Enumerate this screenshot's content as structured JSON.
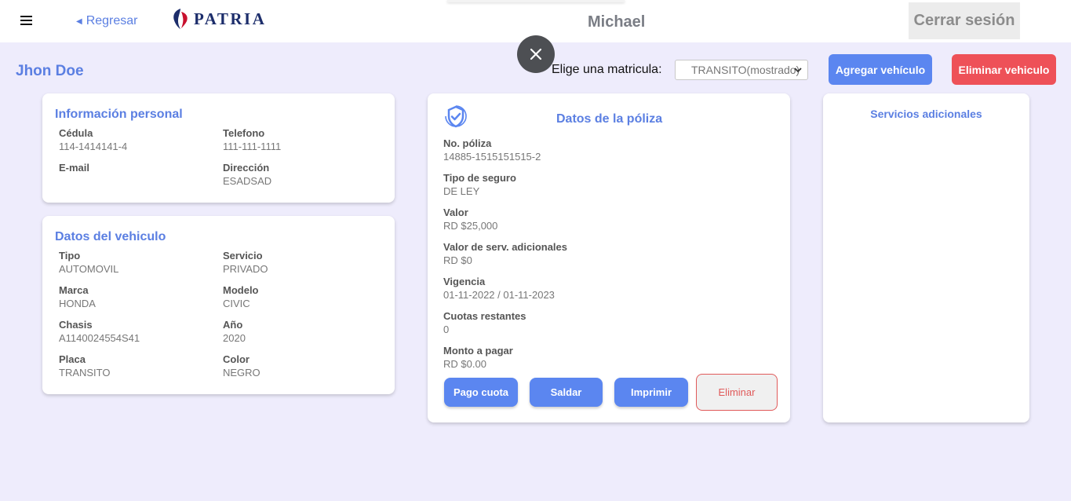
{
  "header": {
    "back_label": "Regresar",
    "brand": "PATRIA",
    "username": "Michael",
    "logout_label": "Cerrar sesión"
  },
  "toolbar": {
    "client_name": "Jhon Doe",
    "plate_label": "Elige una matricula:",
    "plate_selected": "TRANSITO(mostrado)",
    "add_vehicle_label": "Agregar vehículo",
    "delete_vehicle_label": "Eliminar vehiculo"
  },
  "personal": {
    "title": "Información personal",
    "fields": [
      {
        "label": "Cédula",
        "value": "114-1414141-4"
      },
      {
        "label": "Telefono",
        "value": "111-111-1111"
      },
      {
        "label": "E-mail",
        "value": ""
      },
      {
        "label": "Dirección",
        "value": "ESADSAD"
      }
    ]
  },
  "vehicle": {
    "title": "Datos del vehiculo",
    "fields": [
      {
        "label": "Tipo",
        "value": "AUTOMOVIL"
      },
      {
        "label": "Servicio",
        "value": "PRIVADO"
      },
      {
        "label": "Marca",
        "value": "HONDA"
      },
      {
        "label": "Modelo",
        "value": "CIVIC"
      },
      {
        "label": "Chasis",
        "value": "A1140024554S41"
      },
      {
        "label": "Año",
        "value": "2020"
      },
      {
        "label": "Placa",
        "value": "TRANSITO"
      },
      {
        "label": "Color",
        "value": "NEGRO"
      }
    ]
  },
  "policy": {
    "title": "Datos de la póliza",
    "icon": "shield-check-icon",
    "fields": [
      {
        "label": "No. póliza",
        "value": "14885-1515151515-2"
      },
      {
        "label": "Tipo de seguro",
        "value": "DE LEY"
      },
      {
        "label": "Valor",
        "value": "RD $25,000"
      },
      {
        "label": "Valor de serv. adicionales",
        "value": "RD $0"
      },
      {
        "label": "Vigencia",
        "value": "01-11-2022 / 01-11-2023"
      },
      {
        "label": "Cuotas restantes",
        "value": "0"
      },
      {
        "label": "Monto a pagar",
        "value": "RD $0.00"
      }
    ],
    "buttons": {
      "pay_installment": "Pago cuota",
      "settle": "Saldar",
      "print": "Imprimir",
      "delete": "Eliminar"
    }
  },
  "services": {
    "title": "Servicios adicionales"
  },
  "colors": {
    "accent": "#5b86f0",
    "danger": "#ee5158",
    "background": "#eeecfc",
    "brand_navy": "#1c2d6b",
    "brand_red": "#c8102e"
  }
}
